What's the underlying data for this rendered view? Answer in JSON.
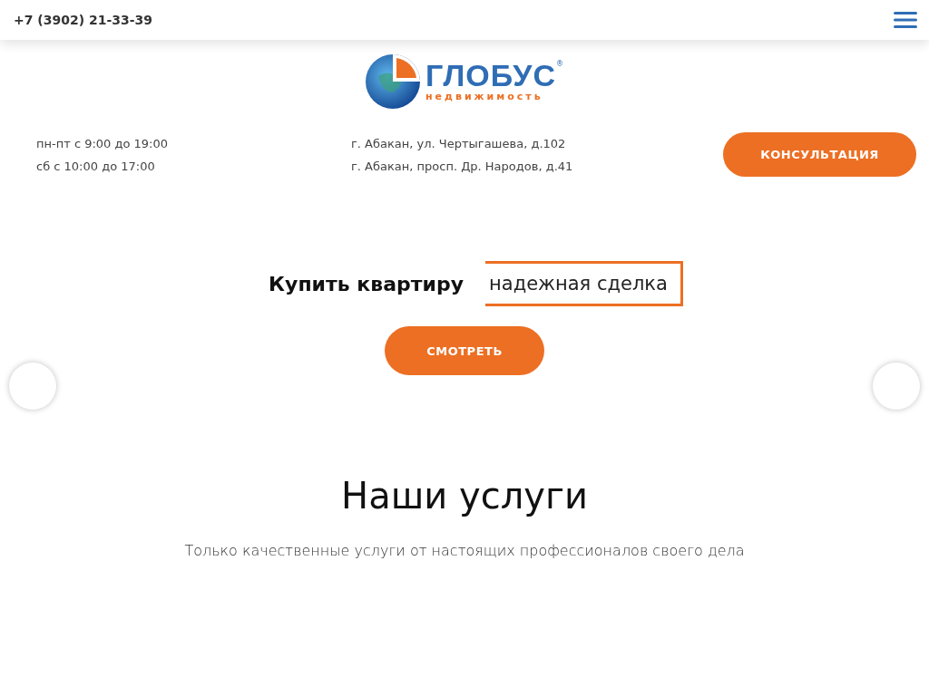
{
  "header": {
    "phone": "+7 (3902) 21-33-39"
  },
  "logo": {
    "name": "ГЛОБУС",
    "mark": "®",
    "tagline": "недвижимость"
  },
  "hours": [
    "пн-пт с 9:00 до 19:00",
    "сб с 10:00 до 17:00"
  ],
  "addresses": [
    "г. Абакан, ул. Чертыгашева, д.102",
    "г. Абакан, просп. Др. Народов, д.41"
  ],
  "consult_button": "КОНСУЛЬТАЦИЯ",
  "hero": {
    "title": "Купить квартиру",
    "highlight": "надежная сделка",
    "button": "СМОТРЕТЬ"
  },
  "services": {
    "title": "Наши услуги",
    "subtitle": "Только качественные услуги от настоящих профессионалов своего дела"
  }
}
